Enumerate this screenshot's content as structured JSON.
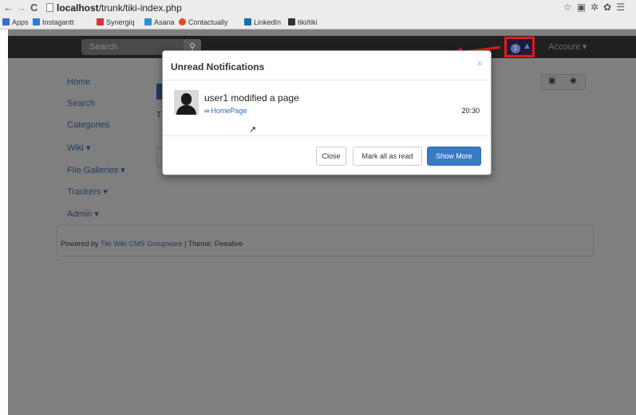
{
  "browser": {
    "url_host": "localhost",
    "url_path": "/trunk/tiki-index.php",
    "bookmarks": [
      {
        "label": "Apps",
        "color": "#3b6bcc"
      },
      {
        "label": "Instagantt",
        "color": "#2a7bd3"
      },
      {
        "label": "Synergiq",
        "color": "#d33"
      },
      {
        "label": "Asana",
        "color": "#2b8fd8"
      },
      {
        "label": "Contactually",
        "color": "#e24a2a"
      },
      {
        "label": "LinkedIn",
        "color": "#1a6fb0"
      },
      {
        "label": "tiki/tiki",
        "color": "#333"
      }
    ]
  },
  "topbar": {
    "search_placeholder": "Search",
    "notification_count": "1",
    "account_label": "Account ▾"
  },
  "side_nav": [
    "Home",
    "Search",
    "Categories",
    "Wiki ▾",
    "File Galleries ▾",
    "Trackers ▾",
    "Admin ▾"
  ],
  "content": {
    "partial_text": "T"
  },
  "footer": {
    "prefix": "Powered by ",
    "link": "Tiki Wiki CMS Groupware",
    "suffix": " | Theme: Fivealive"
  },
  "modal": {
    "title": "Unread Notifications",
    "close_symbol": "×",
    "notification": {
      "message": "user1 modified a page",
      "link_text": "HomePage",
      "time": "20:30"
    },
    "buttons": {
      "close": "Close",
      "mark_all": "Mark all as read",
      "show_more": "Show More"
    }
  },
  "colors": {
    "highlight": "#e01a1a",
    "primary_button": "#3a7bc8"
  }
}
